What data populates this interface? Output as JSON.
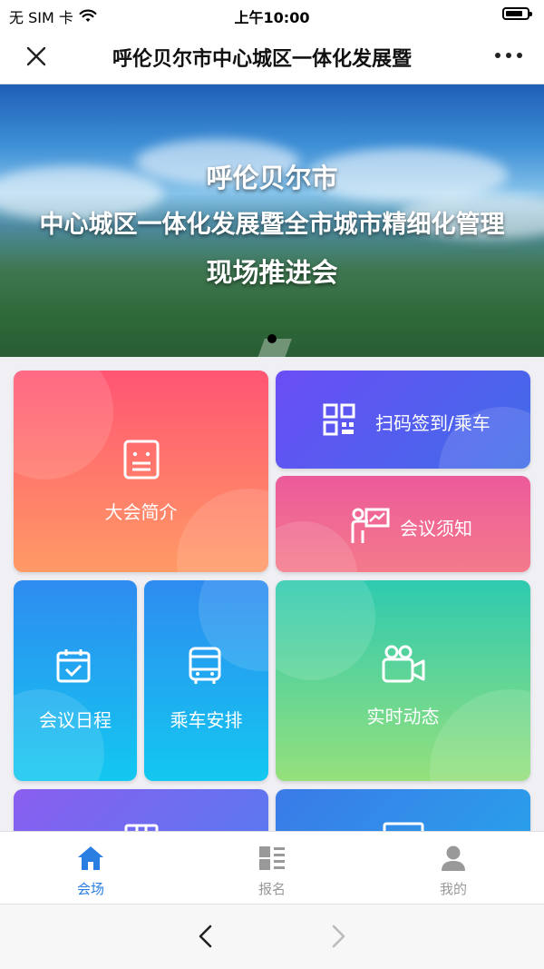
{
  "status_bar": {
    "carrier": "无 SIM 卡",
    "time": "上午10:00",
    "wifi_icon": "wifi-icon",
    "battery_icon": "battery-icon"
  },
  "nav": {
    "title": "呼伦贝尔市中心城区一体化发展暨",
    "close_icon": "close-icon",
    "more_icon": "more-icon"
  },
  "banner": {
    "line1": "呼伦贝尔市",
    "line2": "中心城区一体化发展暨全市城市精细化管理",
    "line3": "现场推进会"
  },
  "tiles": {
    "intro": {
      "label": "大会简介",
      "icon": "document-icon"
    },
    "checkin": {
      "label": "扫码签到/乘车",
      "icon": "qr-code-icon"
    },
    "notice": {
      "label": "会议须知",
      "icon": "presenter-icon"
    },
    "schedule": {
      "label": "会议日程",
      "icon": "calendar-check-icon"
    },
    "bus": {
      "label": "乘车安排",
      "icon": "bus-icon"
    },
    "live": {
      "label": "实时动态",
      "icon": "video-camera-icon"
    }
  },
  "tabbar": {
    "items": [
      {
        "label": "会场",
        "icon": "home-icon",
        "active": true
      },
      {
        "label": "报名",
        "icon": "grid-list-icon",
        "active": false
      },
      {
        "label": "我的",
        "icon": "user-icon",
        "active": false
      }
    ]
  },
  "browser": {
    "back_icon": "chevron-left-icon",
    "forward_icon": "chevron-right-icon"
  },
  "colors": {
    "accent": "#2a7de1",
    "inactive": "#999999"
  }
}
